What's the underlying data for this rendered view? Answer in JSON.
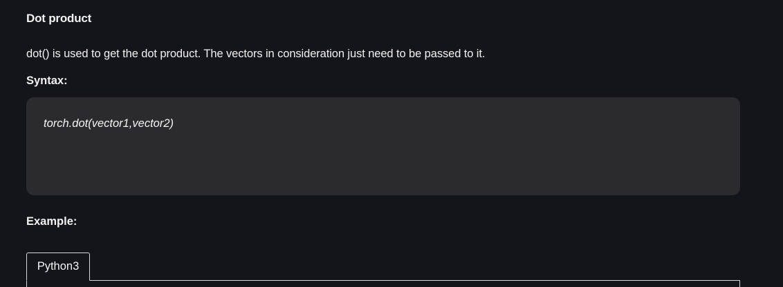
{
  "section": {
    "title": "Dot product",
    "description": "dot() is used to get the dot product. The vectors in consideration just need to be passed to it."
  },
  "syntax": {
    "label": "Syntax:",
    "code": "torch.dot(vector1,vector2)"
  },
  "example": {
    "label": "Example:",
    "tabs": [
      {
        "label": "Python3",
        "active": true
      }
    ]
  },
  "colors": {
    "page_background": "#14151a",
    "code_background": "#2b2b2f",
    "text": "#f2f2f2",
    "tab_border": "#d7d7d7"
  }
}
